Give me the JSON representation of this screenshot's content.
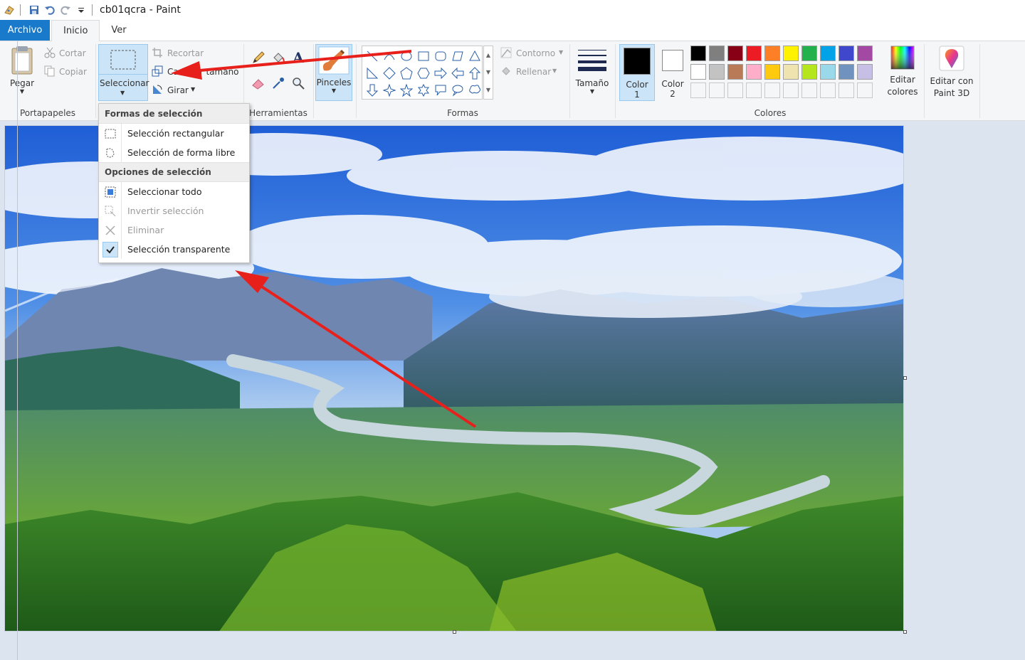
{
  "window": {
    "title": "cb01qcra - Paint"
  },
  "tabs": [
    {
      "label": "Archivo"
    },
    {
      "label": "Inicio"
    },
    {
      "label": "Ver"
    }
  ],
  "clipboard": {
    "paste_label": "Pegar",
    "cut_label": "Cortar",
    "copy_label": "Copiar",
    "group_label": "Portapapeles"
  },
  "image_group": {
    "select_label": "Seleccionar",
    "crop_label": "Recortar",
    "resize_label": "Cambiar tamaño",
    "rotate_label": "Girar"
  },
  "tools": {
    "group_label": "Herramientas"
  },
  "brushes": {
    "label": "Pinceles"
  },
  "shapes": {
    "group_label": "Formas",
    "outline_label": "Contorno",
    "fill_label": "Rellenar"
  },
  "size": {
    "label": "Tamaño"
  },
  "colors": {
    "color1_label": "Color",
    "color1_num": "1",
    "color2_label": "Color",
    "color2_num": "2",
    "group_label": "Colores",
    "edit_label": "Editar colores",
    "paint3d_label": "Editar con Paint 3D",
    "color1": "#000000",
    "color2": "#ffffff",
    "palette_row1": [
      "#000000",
      "#7f7f7f",
      "#880015",
      "#ed1c24",
      "#ff7f27",
      "#fff200",
      "#22b14c",
      "#00a2e8",
      "#3f48cc",
      "#a349a4"
    ],
    "palette_row2": [
      "#ffffff",
      "#c3c3c3",
      "#b97a57",
      "#ffaec9",
      "#ffc90e",
      "#efe4b0",
      "#b5e61d",
      "#99d9ea",
      "#7092be",
      "#c8bfe7"
    ]
  },
  "select_menu": {
    "shapes_header": "Formas de selección",
    "rect": "Selección rectangular",
    "freeform": "Selección de forma libre",
    "options_header": "Opciones de selección",
    "select_all": "Seleccionar todo",
    "invert": "Invertir selección",
    "delete": "Eliminar",
    "transparent": "Selección transparente"
  }
}
